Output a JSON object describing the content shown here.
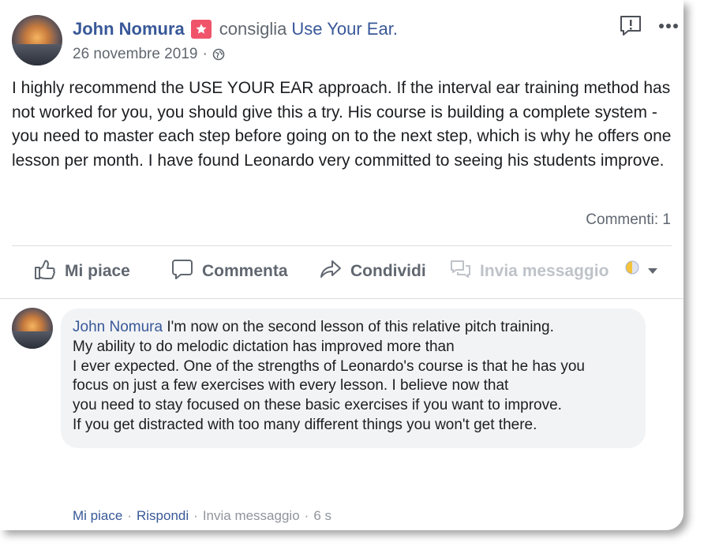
{
  "post": {
    "author": "John Nomura",
    "recommends_text": "consiglia",
    "page_name": "Use Your Ear.",
    "date": "26 novembre 2019",
    "date_separator": "·",
    "body": "I highly recommend the USE YOUR EAR approach. If the interval ear training method has not worked for you, you should give this a try. His course is building a complete system - you need to master each step before going on to the next step, which is why he offers one lesson per month. I have found Leonardo very committed to seeing his students improve.",
    "comments_count": "Commenti: 1"
  },
  "actions": {
    "like": "Mi piace",
    "comment": "Commenta",
    "share": "Condividi",
    "message": "Invia messaggio"
  },
  "comment": {
    "author": "John Nomura",
    "lines": [
      "I'm now on the second lesson of this relative pitch training.",
      "My ability to do melodic dictation has improved more than",
      "I ever expected. One of the strengths of Leonardo's course is that he has you",
      "focus on just a few exercises with every lesson. I believe now that",
      "you need to stay focused on these basic exercises if you want to improve.",
      "If you get distracted with too many different things you won't get there."
    ],
    "like_label": "Mi piace",
    "reply_label": "Rispondi",
    "message_label": "Invia messaggio",
    "time": "6 s",
    "separator": "·"
  },
  "colors": {
    "link_blue": "#385898",
    "secondary_text": "#606770",
    "disabled_text": "#bec3c9",
    "recommend_badge": "#f0546a",
    "comment_bg": "#f2f3f5"
  },
  "icons": [
    "star-badge-icon",
    "globe-icon",
    "report-icon",
    "more-icon",
    "like-icon",
    "comment-icon",
    "share-icon",
    "message-icon",
    "audience-icon",
    "chevron-down-icon"
  ]
}
